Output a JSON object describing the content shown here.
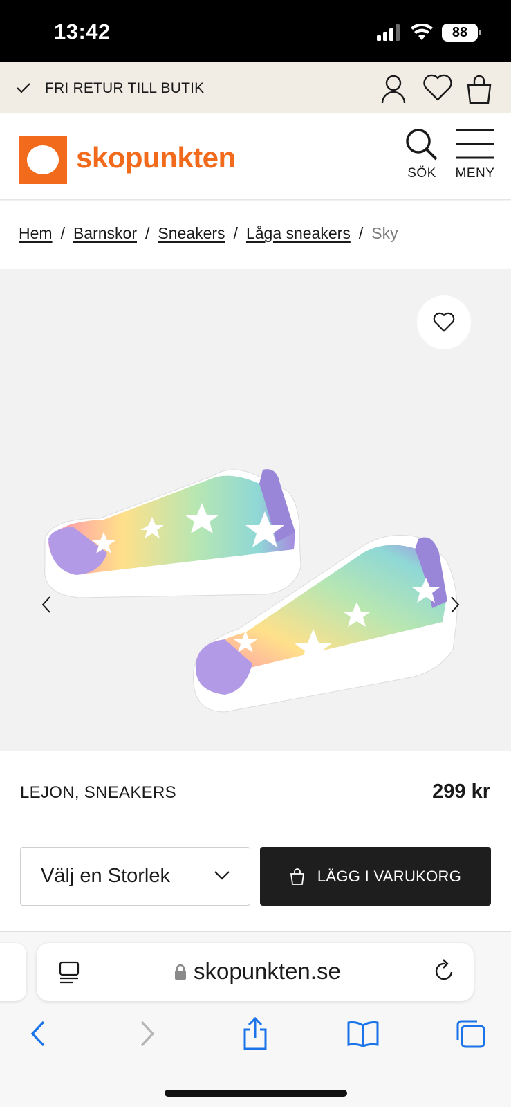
{
  "status_bar": {
    "time": "13:42",
    "battery": "88"
  },
  "promo": {
    "text": "FRI RETUR TILL BUTIK"
  },
  "header": {
    "brand": "skopunkten",
    "search_label": "SÖK",
    "menu_label": "MENY"
  },
  "breadcrumb": {
    "items": [
      "Hem",
      "Barnskor",
      "Sneakers",
      "Låga sneakers"
    ],
    "current": "Sky",
    "separator": "/"
  },
  "product": {
    "name": "LEJON, SNEAKERS",
    "price": "299 kr",
    "size_placeholder": "Välj en Storlek",
    "add_to_cart": "LÄGG I VARUKORG"
  },
  "browser": {
    "url": "skopunkten.se"
  },
  "colors": {
    "brand": "#f26b1d",
    "promo_bg": "#f1ece4",
    "button_bg": "#1e1e1e",
    "ios_blue": "#1a73e8"
  },
  "icons": [
    "check-icon",
    "user-icon",
    "heart-icon",
    "bag-icon",
    "search-icon",
    "menu-icon",
    "chevron-left-icon",
    "chevron-right-icon",
    "chevron-down-icon",
    "lock-icon",
    "reload-icon",
    "share-icon",
    "bookmarks-icon",
    "tabs-icon"
  ]
}
